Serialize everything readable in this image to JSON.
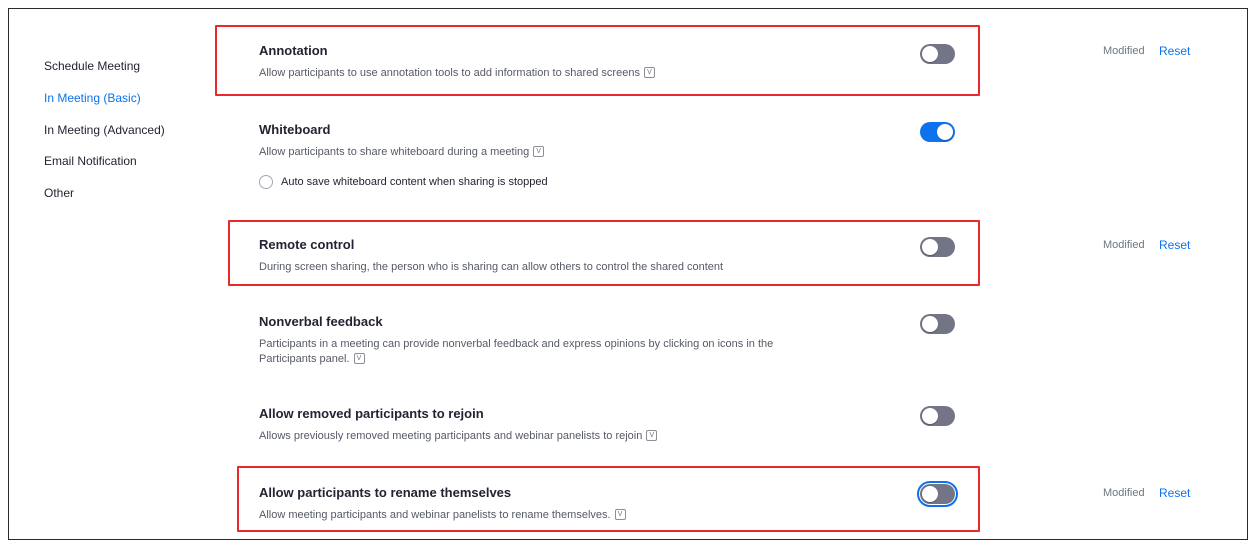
{
  "sidebar": {
    "items": [
      {
        "label": "Schedule Meeting"
      },
      {
        "label": "In Meeting (Basic)"
      },
      {
        "label": "In Meeting (Advanced)"
      },
      {
        "label": "Email Notification"
      },
      {
        "label": "Other"
      }
    ],
    "active_index": 1
  },
  "settings": [
    {
      "title": "Annotation",
      "description": "Allow participants to use annotation tools to add information to shared screens",
      "enabled": false,
      "modified_label": "Modified",
      "reset_label": "Reset"
    },
    {
      "title": "Whiteboard",
      "description": "Allow participants to share whiteboard during a meeting",
      "enabled": true,
      "option": {
        "label": "Auto save whiteboard content when sharing is stopped",
        "checked": false
      }
    },
    {
      "title": "Remote control",
      "description": "During screen sharing, the person who is sharing can allow others to control the shared content",
      "enabled": false,
      "modified_label": "Modified",
      "reset_label": "Reset"
    },
    {
      "title": "Nonverbal feedback",
      "description_line1": "Participants in a meeting can provide nonverbal feedback and express opinions by clicking on icons in the",
      "description_line2": "Participants panel.",
      "enabled": false
    },
    {
      "title": "Allow removed participants to rejoin",
      "description": "Allows previously removed meeting participants and webinar panelists to rejoin",
      "enabled": false
    },
    {
      "title": "Allow participants to rename themselves",
      "description": "Allow meeting participants and webinar panelists to rename themselves.",
      "enabled": false,
      "focused": true,
      "modified_label": "Modified",
      "reset_label": "Reset"
    }
  ],
  "info_icon_glyph": "V",
  "colors": {
    "accent": "#0e72ed",
    "toggle_off": "#747487",
    "highlight": "#e8282b"
  }
}
